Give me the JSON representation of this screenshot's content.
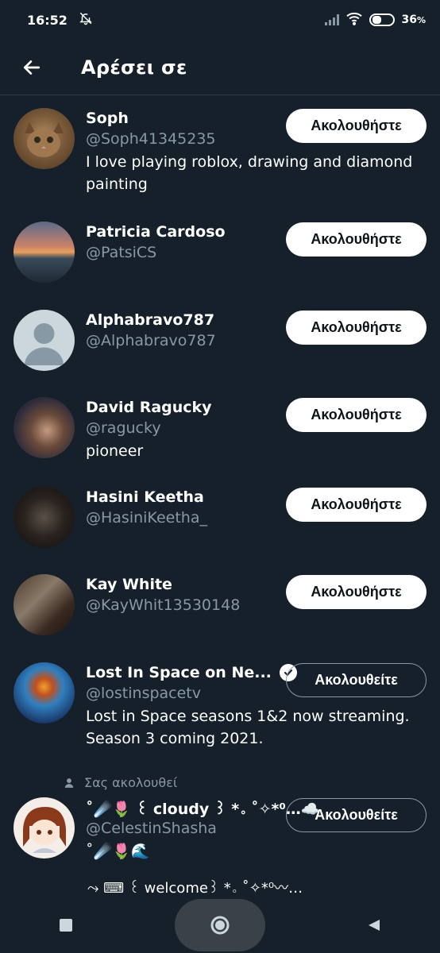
{
  "status_bar": {
    "time": "16:52",
    "battery": "36"
  },
  "header": {
    "title": "Αρέσει σε"
  },
  "users": [
    {
      "name": "Soph",
      "handle": "@Soph41345235",
      "bio": "I love playing roblox, drawing and diamond painting",
      "button": "Ακολουθήστε",
      "state": "follow",
      "avatar": "cat-avatar"
    },
    {
      "name": "Patricia Cardoso",
      "handle": "@PatsiCS",
      "bio": "",
      "button": "Ακολουθήστε",
      "state": "follow",
      "avatar": "sunset-avatar"
    },
    {
      "name": "Alphabravo787",
      "handle": "@Alphabravo787",
      "bio": "",
      "button": "Ακολουθήστε",
      "state": "follow",
      "avatar": "default-avatar"
    },
    {
      "name": "David Ragucky",
      "handle": "@ragucky",
      "bio": "pioneer",
      "button": "Ακολουθήστε",
      "state": "follow",
      "avatar": "photo-avatar"
    },
    {
      "name": "Hasini Keetha",
      "handle": "@HasiniKeetha_",
      "bio": "",
      "button": "Ακολουθήστε",
      "state": "follow",
      "avatar": "photo-avatar"
    },
    {
      "name": "Kay White",
      "handle": "@KayWhit13530148",
      "bio": "",
      "button": "Ακολουθήστε",
      "state": "follow",
      "avatar": "photo-avatar"
    },
    {
      "name": "Lost In Space on Ne...",
      "handle": "@lostinspacetv",
      "bio": "Lost in Space seasons 1&2 now streaming. Season 3 coming 2021.",
      "button": "Ακολουθείτε",
      "state": "following",
      "avatar": "robot-avatar"
    },
    {
      "name": "˚☄️🌷 ꒰ cloudy ꒱ *。˚✧*⁰…☁️",
      "handle": "@CelestinShasha",
      "bio": "˚☄️🌷🌊",
      "button": "Ακολουθείτε",
      "state": "following",
      "avatar": "anime-avatar"
    }
  ],
  "follows_you_label": "Σας ακολουθεί",
  "bottom_snippet": "⤳ ⌨ ꒰ welcome꒱ *。˚✧*⁰〰…"
}
